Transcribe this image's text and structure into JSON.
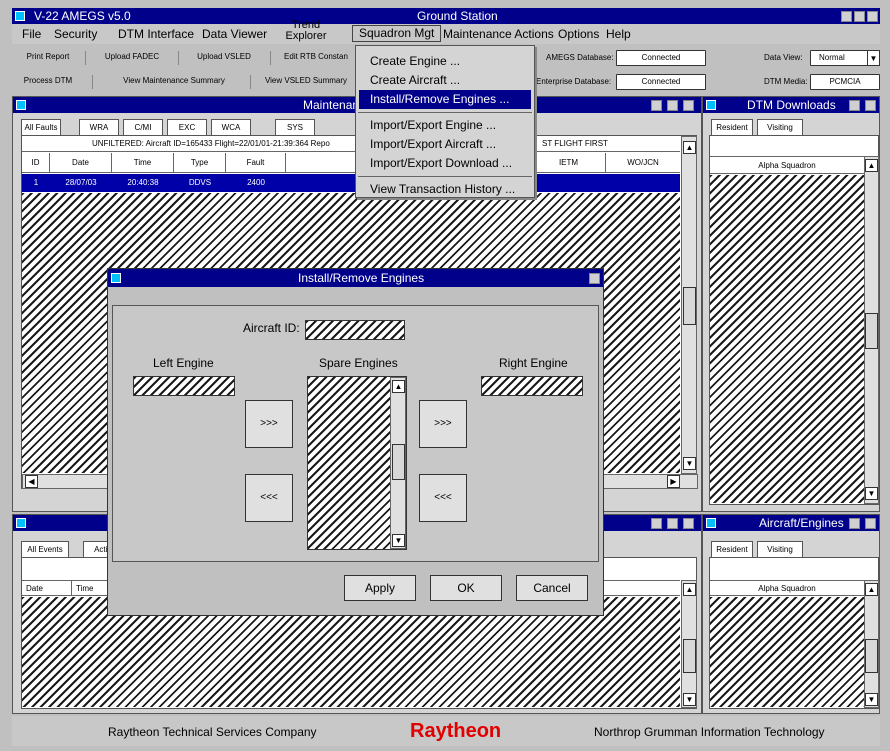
{
  "app": {
    "title": "V-22 AMEGS v5.0",
    "station": "Ground Station"
  },
  "menubar": [
    "File",
    "Security",
    "DTM Interface",
    "Data Viewer",
    "Trend Explorer",
    "Squadron Mgt",
    "Maintenance Actions",
    "Options",
    "Help"
  ],
  "toolbar": {
    "row1": [
      "Print Report",
      "Upload FADEC",
      "Upload VSLED",
      "Edit RTB Constan"
    ],
    "row2": [
      "Process DTM",
      "View Maintenance Summary",
      "View VSLED Summary"
    ]
  },
  "status": {
    "amegs_db_label": "AMEGS Database:",
    "amegs_db_value": "Connected",
    "enterprise_db_label": "Enterprise Database:",
    "enterprise_db_value": "Connected",
    "data_view_label": "Data View:",
    "data_view_value": "Normal",
    "dtm_media_label": "DTM Media:",
    "dtm_media_value": "PCMCIA"
  },
  "dropdown": {
    "items": [
      "Create Engine ...",
      "Create Aircraft ...",
      "Install/Remove Engines ...",
      "Import/Export Engine ...",
      "Import/Export Aircraft ...",
      "Import/Export Download ...",
      "View Transaction History ..."
    ],
    "selected": "Install/Remove Engines ..."
  },
  "maintenance": {
    "title": "Maintenanc",
    "tabs": [
      "All Faults",
      "WRA",
      "C/MI",
      "EXC",
      "WCA",
      "SYS"
    ],
    "filter_left": "UNFILTERED:  Aircraft ID=165433  Flight=22/01/01-21:39:364  Repo",
    "filter_right": "ST FLIGHT FIRST",
    "columns": [
      "ID",
      "Date",
      "Time",
      "Type",
      "Fault"
    ],
    "columns_right": [
      "IETM",
      "WO/JCN"
    ],
    "rows": [
      {
        "id": "1",
        "date": "28/07/03",
        "time": "20:40:38",
        "type": "DDVS",
        "fault": "2400"
      }
    ]
  },
  "events": {
    "tabs": [
      "All Events",
      "Actio"
    ],
    "columns": [
      "Date",
      "Time"
    ]
  },
  "dtm_downloads": {
    "title": "DTM Downloads",
    "tabs": [
      "Resident",
      "Visiting"
    ],
    "header": "Alpha Squadron"
  },
  "aircraft_engines": {
    "title": "Aircraft/Engines",
    "tabs": [
      "Resident",
      "Visiting"
    ],
    "header": "Alpha Squadron"
  },
  "dialog": {
    "title": "Install/Remove Engines",
    "aircraft_id_label": "Aircraft ID:",
    "left_engine_label": "Left Engine",
    "spare_engines_label": "Spare Engines",
    "right_engine_label": "Right Engine",
    "move_right": ">>>",
    "move_left": "<<<",
    "apply": "Apply",
    "ok": "OK",
    "cancel": "Cancel"
  },
  "footer": {
    "left": "Raytheon Technical Services Company",
    "brand": "Raytheon",
    "right": "Northrop Grumman Information Technology",
    "brand_color": "#e00000"
  }
}
